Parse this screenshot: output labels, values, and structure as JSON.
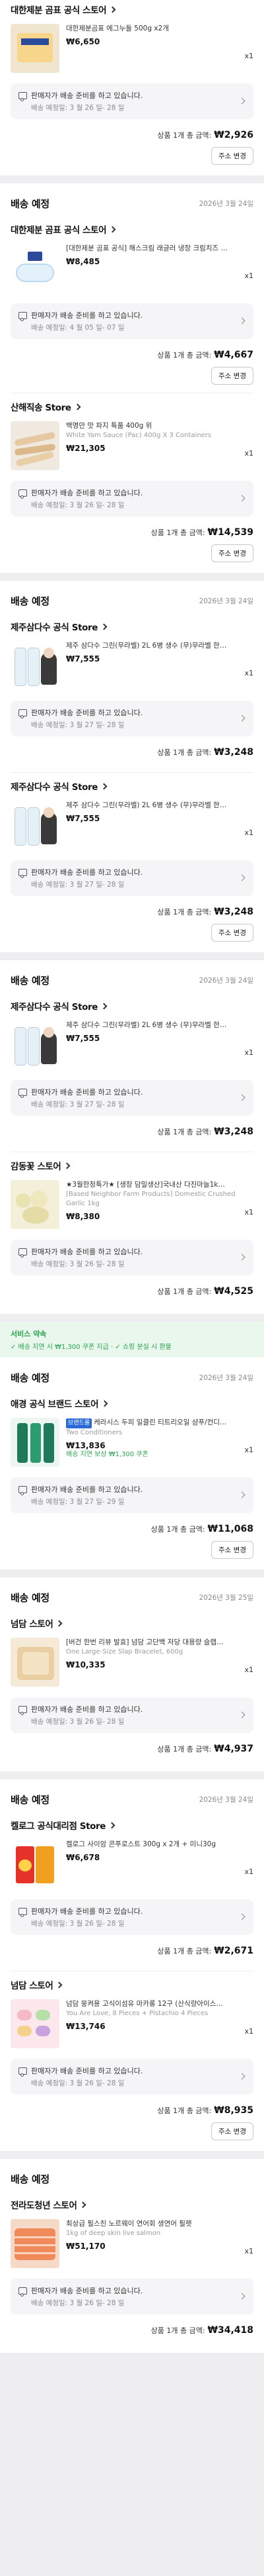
{
  "sec0": {
    "store": "대한제분 곰표 공식 스토어",
    "item": {
      "name": "대한제분곰표 에그누들 500g x2개",
      "price": "₩6,650",
      "qty": "x1"
    },
    "notice": "판매자가 배송 준비를 하고 있습니다.",
    "eta": "배송 예정일: 3 월 26 일- 28 일",
    "total_label": "상품 1개 총 금액:",
    "total": "₩2,926",
    "addr": "주소 변경"
  },
  "sec1": {
    "title": "배송 예정",
    "date": "2026년 3월 24일",
    "store": "대한제분 곰표 공식 스토어",
    "item": {
      "name": "[대한제분 곰표 공식] 해스크림 래글러 냉장 크림치즈 …",
      "price": "₩8,485",
      "qty": "x1"
    },
    "notice": "판매자가 배송 준비를 하고 있습니다.",
    "eta": "배송 예정일: 4 월 05 일- 07 일",
    "total_label": "상품 1개 총 금액:",
    "total": "₩4,667",
    "addr": "주소 변경"
  },
  "sec1b": {
    "store": "산해직송 Store",
    "item": {
      "name": "백명만 맛 파지 특품 400g 위",
      "sub": "White Yam Sauce (Pac) 400g X 3 Containers",
      "price": "₩21,305",
      "qty": "x1"
    },
    "notice": "판매자가 배송 준비를 하고 있습니다.",
    "eta": "배송 예정일: 3 월 26 일- 28 일",
    "total_label": "상품 1개 총 금액:",
    "total": "₩14,539",
    "addr": "주소 변경"
  },
  "sec2": {
    "title": "배송 예정",
    "date": "2026년 3월 24일",
    "store": "제주삼다수 공식 Store",
    "item": {
      "name": "제주 삼다수 그린(무라벨) 2L 6병 생수 (무)무라벨 한…",
      "price": "₩7,555",
      "qty": "x1"
    },
    "notice": "판매자가 배송 준비를 하고 있습니다.",
    "eta": "배송 예정일: 3 월 27 일- 28 일",
    "total_label": "상품 1개 총 금액:",
    "total": "₩3,248"
  },
  "sec2b": {
    "store": "제주삼다수 공식 Store",
    "item": {
      "name": "제주 삼다수 그린(무라벨) 2L 6병 생수 (무)무라벨 한…",
      "price": "₩7,555",
      "qty": "x1"
    },
    "notice": "판매자가 배송 준비를 하고 있습니다.",
    "eta": "배송 예정일: 3 월 27 일- 28 일",
    "total_label": "상품 1개 총 금액:",
    "total": "₩3,248",
    "addr": "주소 변경"
  },
  "sec3": {
    "title": "배송 예정",
    "date": "2026년 3월 24일",
    "store": "제주삼다수 공식 Store",
    "item": {
      "name": "제주 삼다수 그린(무라벨) 2L 6병 생수 (무)무라벨 한…",
      "price": "₩7,555",
      "qty": "x1"
    },
    "notice": "판매자가 배송 준비를 하고 있습니다.",
    "eta": "배송 예정일: 3 월 27 일- 28 일",
    "total_label": "상품 1개 총 금액:",
    "total": "₩3,248"
  },
  "sec3b": {
    "store": "감동꽃 스토어",
    "item": {
      "name": "★3월한정특가★ [생장 담밀생산]국내산 다진마늘1k…",
      "sub": "[Based Neighbor Farm Products] Domestic Crushed Garlic 1kg",
      "price": "₩8,380",
      "qty": "x1"
    },
    "notice": "판매자가 배송 준비를 하고 있습니다.",
    "eta": "배송 예정일: 3 월 26 일- 28 일",
    "total_label": "상품 1개 총 금액:",
    "total": "₩4,525"
  },
  "sec4": {
    "benefit1": "서비스 약속",
    "benefit2": "✓ 배송 지연 시 ₩1,300 쿠폰 지급 · ✓ 쇼핑 분실 시 환불",
    "title": "배송 예정",
    "date": "2026년 3월 24일",
    "store": "애경 공식 브랜드 스토어",
    "item": {
      "tag": "브랜드몰",
      "name": "케라시스 두피 일클린 티트리오일 샴푸/컨디…",
      "sub": "Two Conditioners",
      "price": "₩13,836",
      "discount": "배송 지연 보상 ₩1,300 쿠폰",
      "qty": "x1"
    },
    "notice": "판매자가 배송 준비를 하고 있습니다.",
    "eta": "배송 예정일: 3 월 27 일- 29 일",
    "total_label": "상품 1개 총 금액:",
    "total": "₩11,068",
    "addr": "주소 변경"
  },
  "sec5": {
    "title": "배송 예정",
    "date": "2026년 3월 25일",
    "store": "넘담 스토어",
    "item": {
      "name": "[버건 한번 리뷰 발효] 넘담 고단백 저당 대용량 슬랩…",
      "sub": "One Large-Size Slap Bracelet, 600g",
      "price": "₩10,335",
      "qty": "x1"
    },
    "notice": "판매자가 배송 준비를 하고 있습니다.",
    "eta": "배송 예정일: 3 월 26 일- 28 일",
    "total_label": "상품 1개 총 금액:",
    "total": "₩4,937"
  },
  "sec6": {
    "title": "배송 예정",
    "date": "2026년 3월 24일",
    "store": "켈로그 공식대리점 Store",
    "item": {
      "name": "켈로그 사이암 콘푸로스트 300g x 2개 + 미니30g",
      "price": "₩6,678",
      "qty": "x1"
    },
    "notice": "판매자가 배송 준비를 하고 있습니다.",
    "eta": "배송 예정일: 3 월 26 일- 28 일",
    "total_label": "상품 1개 총 금액:",
    "total": "₩2,671"
  },
  "sec6b": {
    "store": "넘담 스토어",
    "item": {
      "name": "넘담 뭉켜용 고식이섬유 마카롱 12구 (산식량아이스…",
      "sub": "You Are Love, 8 Pieces + Pistachio 4 Pieces",
      "price": "₩13,746",
      "qty": "x1"
    },
    "notice": "판매자가 배송 준비를 하고 있습니다.",
    "eta": "배송 예정일: 3 월 26 일- 28 일",
    "total_label": "상품 1개 총 금액:",
    "total": "₩8,935",
    "addr": "주소 변경"
  },
  "sec7": {
    "title": "배송 예정",
    "store": "전라도청년 스토어",
    "item": {
      "name": "최상급 필스친 노르웨이 연어회 생연어 필렛",
      "sub": "1kg of deep skin live salmon",
      "price": "₩51,170",
      "qty": "x1"
    },
    "notice": "판매자가 배송 준비를 하고 있습니다.",
    "eta": "배송 예정일: 3 월 26 일- 28 일",
    "total_label": "상품 1개 총 금액:",
    "total": "₩34,418"
  }
}
